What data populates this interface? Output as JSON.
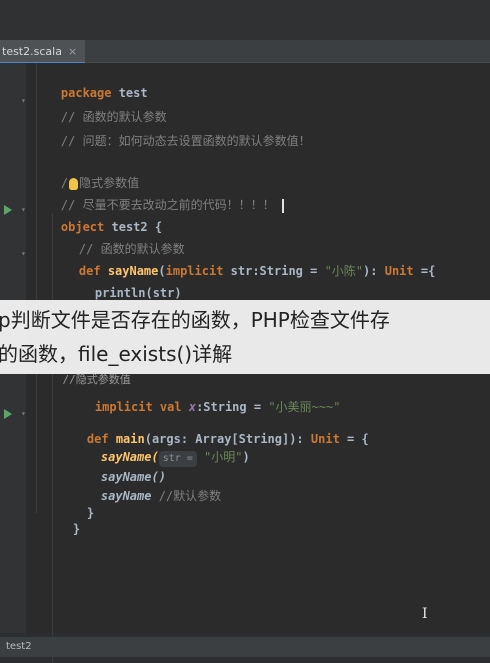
{
  "tab": {
    "filename": "test2.scala",
    "close": "×"
  },
  "lines": {
    "l1_kw": "package",
    "l1_name": " test",
    "l2": "// 函数的默认参数",
    "l3": "// 问题：如何动态去设置函数的默认参数值！",
    "l4_a": "/",
    "l4_b": "隐式参数值",
    "l5": "// 尽量不要去改动之前的代码！！！！",
    "l6_kw": "object",
    "l6_name": " test2 {",
    "l7": "// 函数的默认参数",
    "l8_def": "def ",
    "l8_fn": "sayName",
    "l8_open": "(",
    "l8_impl": "implicit",
    "l8_param": " str:String = ",
    "l8_str": "\"小陈\"",
    "l8_close": "): ",
    "l8_unit": "Unit",
    "l8_end": " ={",
    "l9": "println(str)",
    "l11": "//隐式参数值",
    "l12_kw": "implicit",
    "l12_rest": " val ",
    "l12_var": "x",
    "l12_end": ":String = ",
    "l12_str": "\"小美丽~~~\"",
    "l14_def": "def ",
    "l14_fn": "main",
    "l14_mid": "(args: Array[String]): ",
    "l14_unit": "Unit",
    "l14_end": " = {",
    "l15_fn": "sayName(",
    "l15_hint": "str =",
    "l15_str": " \"小明\"",
    "l15_end": ")",
    "l16": "sayName()",
    "l17_fn": "sayName",
    "l17_cm": " //默认参数",
    "l18": "}",
    "l19": "}"
  },
  "overlay": {
    "line1": "p判断文件是否存在的函数，PHP检查文件存",
    "line2": "的函数，file_exists()详解"
  },
  "status": {
    "label": "test2"
  },
  "icons": [
    "run-icon",
    "lightbulb-icon",
    "text-cursor-icon",
    "close-icon"
  ]
}
